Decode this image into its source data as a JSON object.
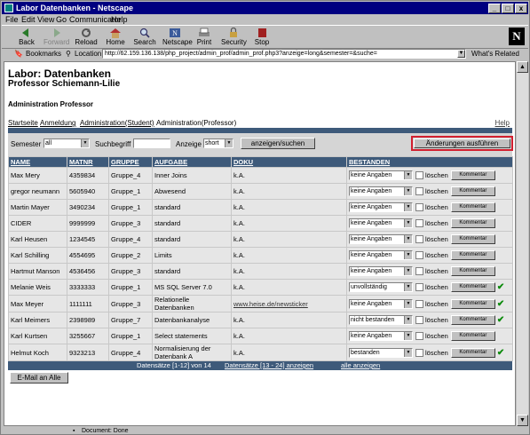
{
  "window": {
    "title": "Labor Datenbanken - Netscape",
    "min": "_",
    "max": "□",
    "close": "x"
  },
  "menu": [
    "File",
    "Edit",
    "View",
    "Go",
    "Communicator",
    "Help"
  ],
  "toolbar": [
    "Back",
    "Forward",
    "Reload",
    "Home",
    "Search",
    "Netscape",
    "Print",
    "Security",
    "Stop"
  ],
  "logo_letter": "N",
  "location": {
    "bookmarks": "Bookmarks",
    "label": "Location:",
    "url": "http://62.159.136.138/php_project/admin_prof/admin_prof.php3?anzeige=long&semester=&suche=",
    "related": "What's Related"
  },
  "page": {
    "title": "Labor: Datenbanken",
    "subtitle": "Professor Schiemann-Lilie",
    "section": "Administration Professor",
    "nav": [
      "Startseite",
      "Anmeldung",
      "Administration(Student)",
      "Administration(Professor)"
    ],
    "help": "Help"
  },
  "filter": {
    "semester_label": "Semester",
    "semester_value": "all",
    "search_label": "Suchbegriff",
    "search_value": "",
    "display_label": "Anzeige",
    "display_value": "short",
    "show_button": "anzeigen/suchen",
    "apply_button": "Änderungen ausführen"
  },
  "table": {
    "headers": [
      "NAME",
      "MATNR",
      "GRUPPE",
      "AUFGABE",
      "DOKU",
      "BESTANDEN"
    ],
    "delete_label": "löschen",
    "comment_label": "Kommentar",
    "rows": [
      {
        "name": "Max Mery",
        "matnr": "4359834",
        "gruppe": "Gruppe_4",
        "aufgabe": "Inner Joins",
        "doku": "k.A.",
        "status": "keine Angaben",
        "check": ""
      },
      {
        "name": "gregor neumann",
        "matnr": "5605940",
        "gruppe": "Gruppe_1",
        "aufgabe": "Abwesend",
        "doku": "k.A.",
        "status": "keine Angaben",
        "check": ""
      },
      {
        "name": "Martin Mayer",
        "matnr": "3490234",
        "gruppe": "Gruppe_1",
        "aufgabe": "standard",
        "doku": "k.A.",
        "status": "keine Angaben",
        "check": ""
      },
      {
        "name": "CIDER",
        "matnr": "9999999",
        "gruppe": "Gruppe_3",
        "aufgabe": "standard",
        "doku": "k.A.",
        "status": "keine Angaben",
        "check": ""
      },
      {
        "name": "Karl Heusen",
        "matnr": "1234545",
        "gruppe": "Gruppe_4",
        "aufgabe": "standard",
        "doku": "k.A.",
        "status": "keine Angaben",
        "check": ""
      },
      {
        "name": "Karl Schilling",
        "matnr": "4554695",
        "gruppe": "Gruppe_2",
        "aufgabe": "Limits",
        "doku": "k.A.",
        "status": "keine Angaben",
        "check": ""
      },
      {
        "name": "Hartmut Manson",
        "matnr": "4536456",
        "gruppe": "Gruppe_3",
        "aufgabe": "standard",
        "doku": "k.A.",
        "status": "keine Angaben",
        "check": ""
      },
      {
        "name": "Melanie Weis",
        "matnr": "3333333",
        "gruppe": "Gruppe_1",
        "aufgabe": "MS SQL Server 7.0",
        "doku": "k.A.",
        "status": "unvollständig",
        "check": "✔"
      },
      {
        "name": "Max Meyer",
        "matnr": "1111111",
        "gruppe": "Gruppe_3",
        "aufgabe": "Relationelle Datenbanken",
        "doku": "www.heise.de/newsticker",
        "status": "keine Angaben",
        "check": "✔"
      },
      {
        "name": "Karl Meimers",
        "matnr": "2398989",
        "gruppe": "Gruppe_7",
        "aufgabe": "Datenbankanalyse",
        "doku": "k.A.",
        "status": "nicht bestanden",
        "check": "✔"
      },
      {
        "name": "Karl Kurtsen",
        "matnr": "3255667",
        "gruppe": "Gruppe_1",
        "aufgabe": "Select statements",
        "doku": "k.A.",
        "status": "keine Angaben",
        "check": ""
      },
      {
        "name": "Helmut Koch",
        "matnr": "9323213",
        "gruppe": "Gruppe_4",
        "aufgabe": "Normalisierung der Datenbank A",
        "doku": "k.A.",
        "status": "bestanden",
        "check": "✔"
      }
    ]
  },
  "pagination": {
    "current": "Datensätze [1-12] von 14",
    "next": "Datensätze [13 - 24] anzeigen",
    "all": "alle anzeigen"
  },
  "email_button": "E-Mail an Alle",
  "status_text": "Document: Done"
}
